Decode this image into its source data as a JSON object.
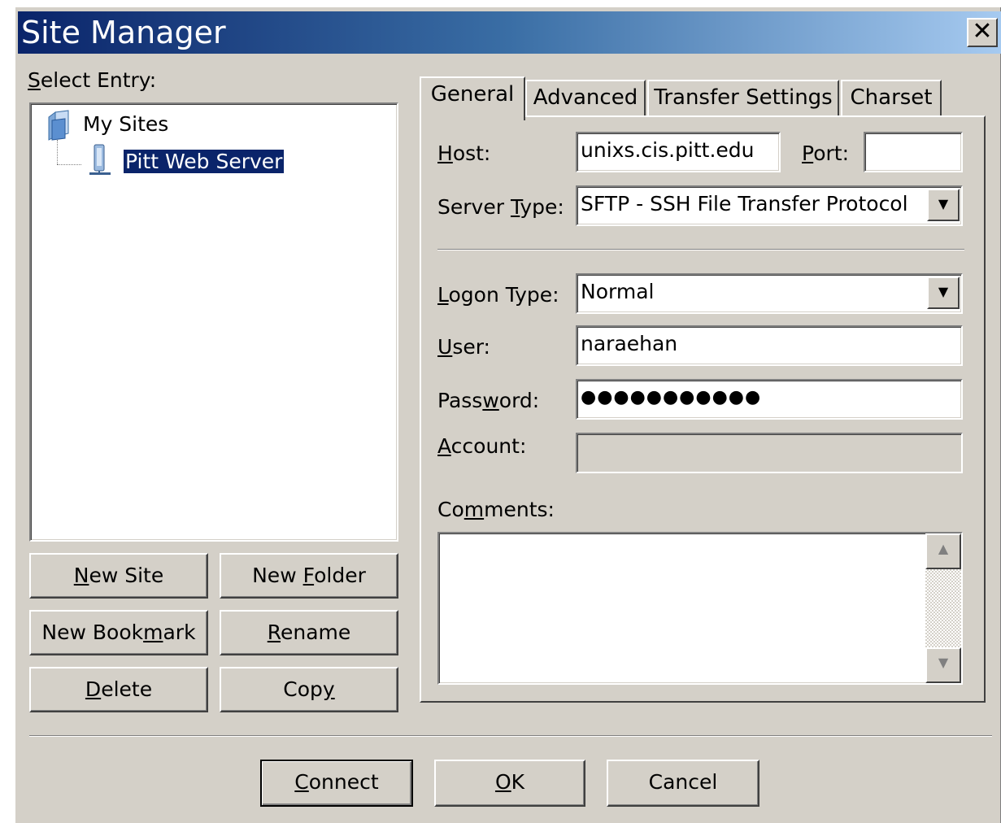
{
  "window": {
    "title": "Site Manager",
    "close_symbol": "✕"
  },
  "select_entry": {
    "label": "Select Entry:",
    "mnemonic": "S",
    "rest": "elect Entry:"
  },
  "tree": {
    "root": {
      "label": "My Sites",
      "icon": "folder-icon"
    },
    "child": {
      "label": "Pitt Web Server",
      "icon": "server-icon",
      "selected": true
    }
  },
  "site_buttons": {
    "new_site": {
      "pre": "",
      "key": "N",
      "post": "ew Site"
    },
    "new_folder": {
      "pre": "New ",
      "key": "F",
      "post": "older"
    },
    "new_bookmark": {
      "pre": "New Book",
      "key": "m",
      "post": "ark"
    },
    "rename": {
      "pre": "",
      "key": "R",
      "post": "ename"
    },
    "delete": {
      "pre": "",
      "key": "D",
      "post": "elete"
    },
    "copy": {
      "pre": "Cop",
      "key": "y",
      "post": ""
    }
  },
  "tabs": [
    {
      "label": "General",
      "active": true
    },
    {
      "label": "Advanced",
      "active": false
    },
    {
      "label": "Transfer Settings",
      "active": false
    },
    {
      "label": "Charset",
      "active": false
    }
  ],
  "general": {
    "host": {
      "pre": "",
      "key": "H",
      "post": "ost:",
      "value": "unixs.cis.pitt.edu"
    },
    "port": {
      "pre": "",
      "key": "P",
      "post": "ort:",
      "value": ""
    },
    "server_type": {
      "pre": "Server ",
      "key": "T",
      "post": "ype:",
      "value": "SFTP - SSH File Transfer Protocol"
    },
    "logon_type": {
      "pre": "",
      "key": "L",
      "post": "ogon Type:",
      "value": "Normal"
    },
    "user": {
      "pre": "",
      "key": "U",
      "post": "ser:",
      "value": "naraehan"
    },
    "password": {
      "pre": "Pass",
      "key": "w",
      "post": "ord:",
      "value": "●●●●●●●●●●●"
    },
    "account": {
      "pre": "",
      "key": "A",
      "post": "ccount:",
      "value": ""
    },
    "comments": {
      "pre": "Co",
      "key": "m",
      "post": "ments:",
      "value": ""
    }
  },
  "dropdown_arrow": "▼",
  "scroll_up": "▲",
  "scroll_down": "▼",
  "bottom_buttons": {
    "connect": {
      "pre": "",
      "key": "C",
      "post": "onnect"
    },
    "ok": {
      "pre": "",
      "key": "O",
      "post": "K"
    },
    "cancel": {
      "pre": "Cancel",
      "key": "",
      "post": ""
    }
  }
}
